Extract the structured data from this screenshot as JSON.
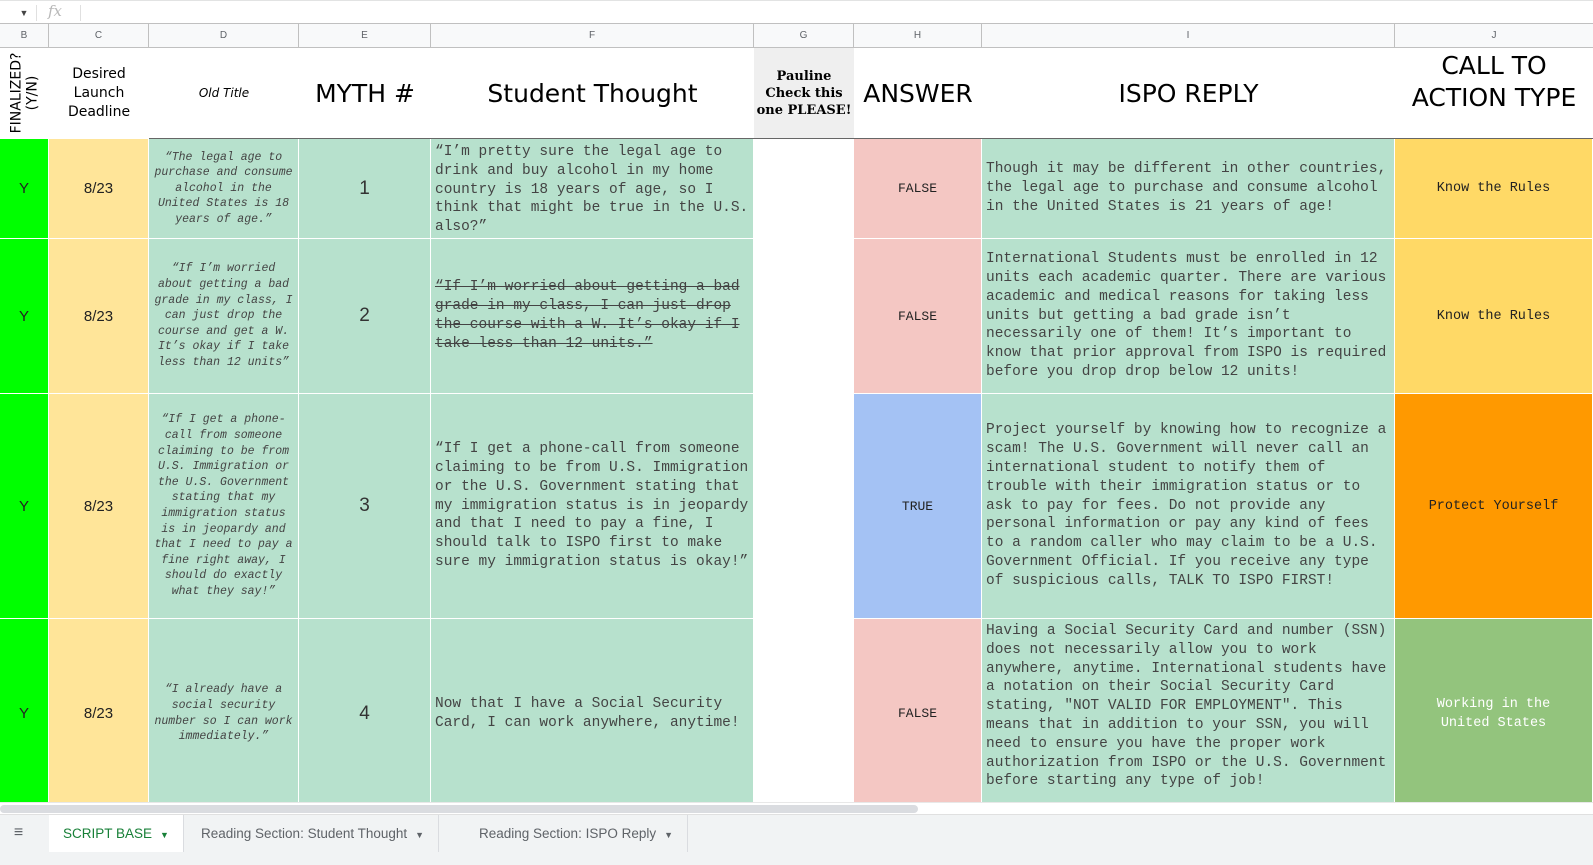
{
  "formula_bar": {
    "name_box_dropdown_icon": "caret-down-icon",
    "fx_label": "fx",
    "value": ""
  },
  "columns": [
    "B",
    "C",
    "D",
    "E",
    "F",
    "G",
    "H",
    "I",
    "J"
  ],
  "headers": {
    "finalized": "FINALIZED? (Y/N)",
    "deadline": "Desired Launch Deadline",
    "old_title": "Old Title",
    "myth_num": "MYTH #",
    "student_thought": "Student Thought",
    "pauline": "Pauline Check this one PLEASE!",
    "answer": "ANSWER",
    "ispo_reply": "ISPO REPLY",
    "cta_type": "CALL TO ACTION TYPE"
  },
  "colors": {
    "finalized_green": "#00ff00",
    "deadline_yellow": "#ffe599",
    "content_teal": "#b7e1cd",
    "false_pink": "#f4c7c3",
    "true_blue": "#a4c2f4",
    "cta_know_rules": "#ffd966",
    "cta_protect": "#ff9900",
    "cta_working": "#93c47d",
    "pauline_gray": "#efefef"
  },
  "rows": [
    {
      "finalized": "Y",
      "deadline": "8/23",
      "old_title": "“The legal age to purchase and consume alcohol in the United States is 18 years of age.”",
      "myth_num": "1",
      "student_thought": "“I’m pretty sure the legal age to drink and buy alcohol in my home country is 18 years of age, so I think that might be true in the U.S. also?”",
      "student_thought_strikethrough": false,
      "pauline": "",
      "answer": "FALSE",
      "ispo_reply": "Though it may be different in other countries, the legal age to purchase and consume alcohol in the United States is 21 years of age!",
      "cta_type": "Know the Rules"
    },
    {
      "finalized": "Y",
      "deadline": "8/23",
      "old_title": "“If I’m worried about getting a bad grade in my class, I can just drop the course and get a W. It’s okay if I take less than 12 units”",
      "myth_num": "2",
      "student_thought": "“If I’m worried about getting a bad grade in my class, I can just drop the course with a W. It’s okay if I take less than 12 units.”",
      "student_thought_strikethrough": true,
      "pauline": "",
      "answer": "FALSE",
      "ispo_reply": "International Students must be enrolled in 12 units each academic quarter. There are various academic and medical reasons for taking less units but getting a bad grade isn’t necessarily one of them! It’s important to know that prior approval from ISPO is required before you drop drop below 12 units!",
      "cta_type": "Know the Rules"
    },
    {
      "finalized": "Y",
      "deadline": "8/23",
      "old_title": "“If I get a phone-call from someone claiming to be from U.S. Immigration or the U.S. Government stating that my immigration status is in jeopardy and that I need to pay a fine right away, I should do exactly what they say!”",
      "myth_num": "3",
      "student_thought": "“If I get a phone-call from someone claiming to be from U.S. Immigration or the U.S. Government stating that my immigration status is in jeopardy and that I need to pay a fine, I should talk to ISPO first to make sure my immigration status is okay!”",
      "student_thought_strikethrough": false,
      "pauline": "",
      "answer": "TRUE",
      "ispo_reply": "Project yourself by knowing how to recognize a scam! The U.S. Government will never call an international student to notify them of trouble with their immigration status or to ask to pay for fees. Do not provide any personal information or pay any kind of fees to a random caller who may claim to be a U.S. Government Official. If you receive any type of suspicious calls, TALK TO ISPO FIRST!",
      "cta_type": "Protect Yourself"
    },
    {
      "finalized": "Y",
      "deadline": "8/23",
      "old_title": "“I already have a social security number so I can work immediately.”",
      "myth_num": "4",
      "student_thought": "Now that I have a Social Security Card, I can work anywhere, anytime!",
      "student_thought_strikethrough": false,
      "pauline": "",
      "answer": "FALSE",
      "ispo_reply": "Having a Social Security Card and number (SSN) does not necessarily allow you to work anywhere, anytime. International students have a notation on their Social Security Card stating, \"NOT VALID FOR EMPLOYMENT\". This means that in addition to your SSN, you will need to ensure you have the proper work authorization from ISPO or the U.S. Government before starting any type of job!",
      "cta_type": "Working in the United States"
    }
  ],
  "sheet_tabs": {
    "all_sheets_icon": "list-icon",
    "tabs": [
      {
        "label": "SCRIPT BASE",
        "active": true
      },
      {
        "label": "Reading Section: Student Thought",
        "active": false
      },
      {
        "label": "Reading Section: ISPO Reply",
        "active": false
      }
    ]
  }
}
